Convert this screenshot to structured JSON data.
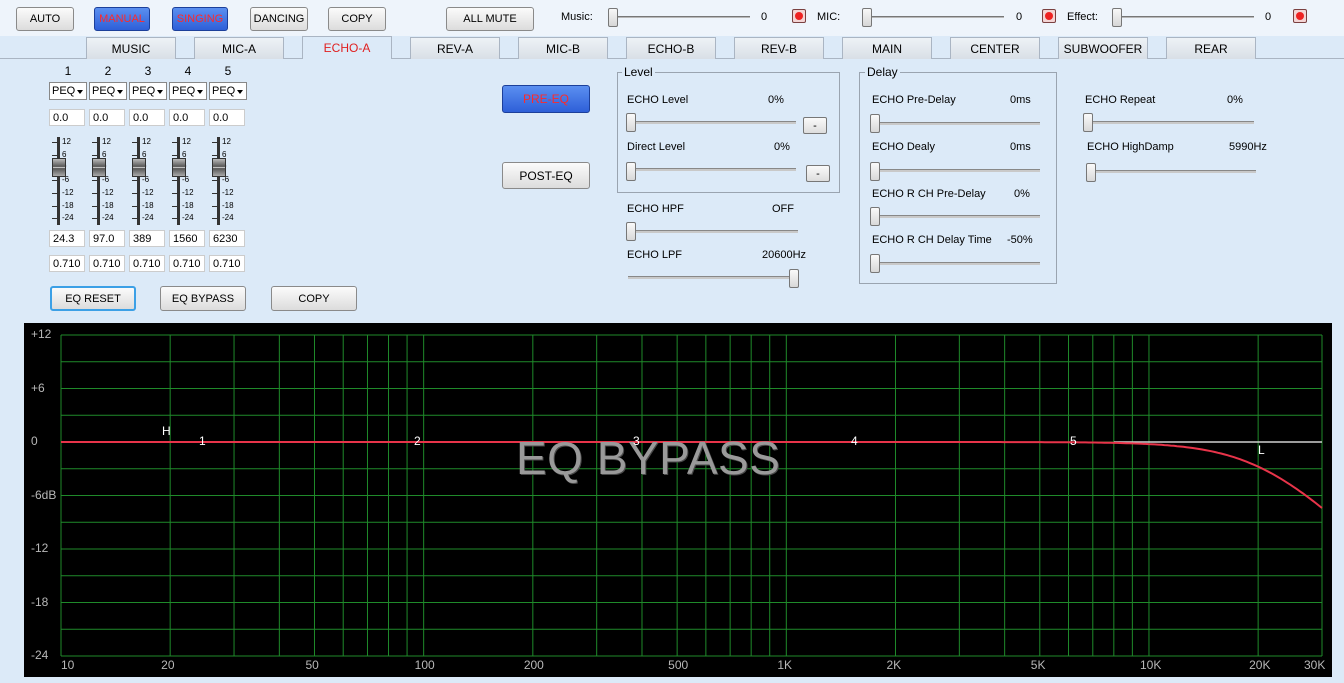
{
  "top": {
    "buttons": {
      "auto": "AUTO",
      "manual": "MANUAL",
      "singing": "SINGING",
      "dancing": "DANCING",
      "copy": "COPY",
      "all_mute": "ALL MUTE"
    },
    "music_label": "Music:",
    "music_value": "0",
    "mic_label": "MIC:",
    "mic_value": "0",
    "effect_label": "Effect:",
    "effect_value": "0"
  },
  "tabs": [
    "MUSIC",
    "MIC-A",
    "ECHO-A",
    "REV-A",
    "MIC-B",
    "ECHO-B",
    "REV-B",
    "MAIN",
    "CENTER",
    "SUBWOOFER",
    "REAR"
  ],
  "active_tab": "ECHO-A",
  "eq": {
    "channels": [
      {
        "num": "1",
        "type": "PEQ",
        "gain": "0.0",
        "freq": "24.3",
        "q": "0.710"
      },
      {
        "num": "2",
        "type": "PEQ",
        "gain": "0.0",
        "freq": "97.0",
        "q": "0.710"
      },
      {
        "num": "3",
        "type": "PEQ",
        "gain": "0.0",
        "freq": "389",
        "q": "0.710"
      },
      {
        "num": "4",
        "type": "PEQ",
        "gain": "0.0",
        "freq": "1560",
        "q": "0.710"
      },
      {
        "num": "5",
        "type": "PEQ",
        "gain": "0.0",
        "freq": "6230",
        "q": "0.710"
      }
    ],
    "scale": [
      "12",
      "6",
      "0",
      "-6",
      "-12",
      "-18",
      "-24"
    ],
    "reset": "EQ RESET",
    "bypass": "EQ BYPASS",
    "copy": "COPY"
  },
  "routing": {
    "pre": "PRE-EQ",
    "post": "POST-EQ"
  },
  "level": {
    "title": "Level",
    "echo_level_label": "ECHO Level",
    "echo_level_value": "0%",
    "direct_level_label": "Direct Level",
    "direct_level_value": "0%",
    "minus": "-"
  },
  "filters": {
    "hpf_label": "ECHO HPF",
    "hpf_value": "OFF",
    "lpf_label": "ECHO LPF",
    "lpf_value": "20600Hz"
  },
  "delay": {
    "title": "Delay",
    "pre_delay_label": "ECHO Pre-Delay",
    "pre_delay_value": "0ms",
    "dealy_label": "ECHO Dealy",
    "dealy_value": "0ms",
    "r_pre_delay_label": "ECHO R CH Pre-Delay",
    "r_pre_delay_value": "0%",
    "r_delay_time_label": "ECHO R CH Delay Time",
    "r_delay_time_value": "-50%"
  },
  "extra": {
    "repeat_label": "ECHO Repeat",
    "repeat_value": "0%",
    "highdamp_label": "ECHO HighDamp",
    "highdamp_value": "5990Hz"
  },
  "graph": {
    "y_labels": [
      "+12",
      "+6",
      "0",
      "-6dB",
      "-12",
      "-18",
      "-24"
    ],
    "x_labels": [
      "10",
      "20",
      "50",
      "100",
      "200",
      "500",
      "1K",
      "2K",
      "5K",
      "10K",
      "20K",
      "30K"
    ],
    "overlay": "EQ BYPASS",
    "markers": {
      "h": "H",
      "l": "L",
      "bands": [
        "1",
        "2",
        "3",
        "4",
        "5"
      ]
    },
    "colors": {
      "grid": "#1f8a2a",
      "curve": "#e8344a",
      "flat": "#d0d0d0"
    }
  }
}
